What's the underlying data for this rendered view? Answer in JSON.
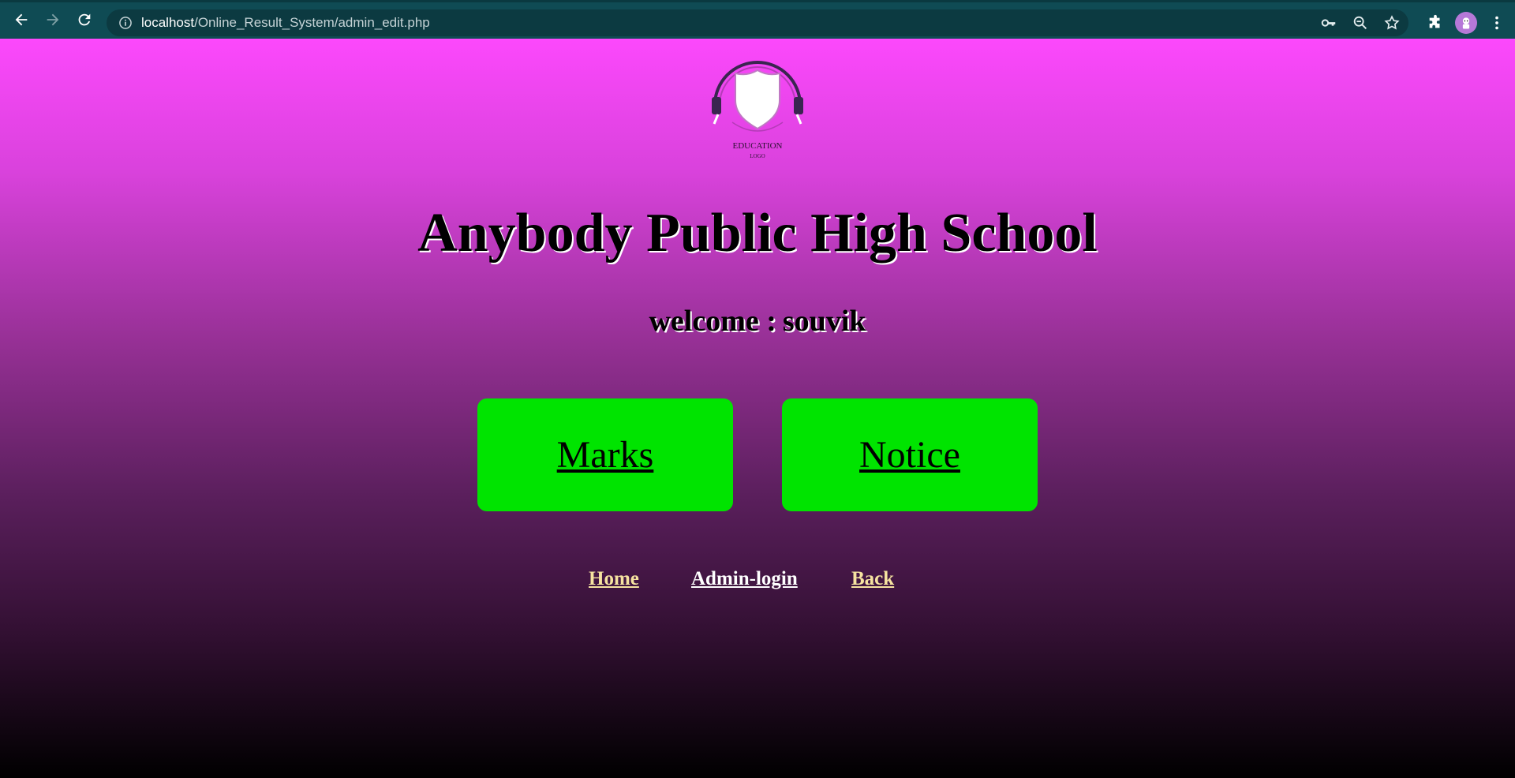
{
  "browser": {
    "url_host": "localhost",
    "url_path": "/Online_Result_System/admin_edit.php"
  },
  "logo": {
    "line1": "EDUCATION",
    "line2": "LOGO"
  },
  "header": {
    "school_name": "Anybody Public High School",
    "welcome_label": "welcome :",
    "username": "souvik"
  },
  "tiles": {
    "marks": "Marks",
    "notice": "Notice"
  },
  "footer": {
    "home": "Home",
    "admin_login": "Admin-login",
    "back": "Back"
  },
  "colors": {
    "tile_bg": "#00e400",
    "gradient_top": "#fc48fc",
    "gradient_bottom": "#000000",
    "chrome_bg": "#0f4b54"
  }
}
